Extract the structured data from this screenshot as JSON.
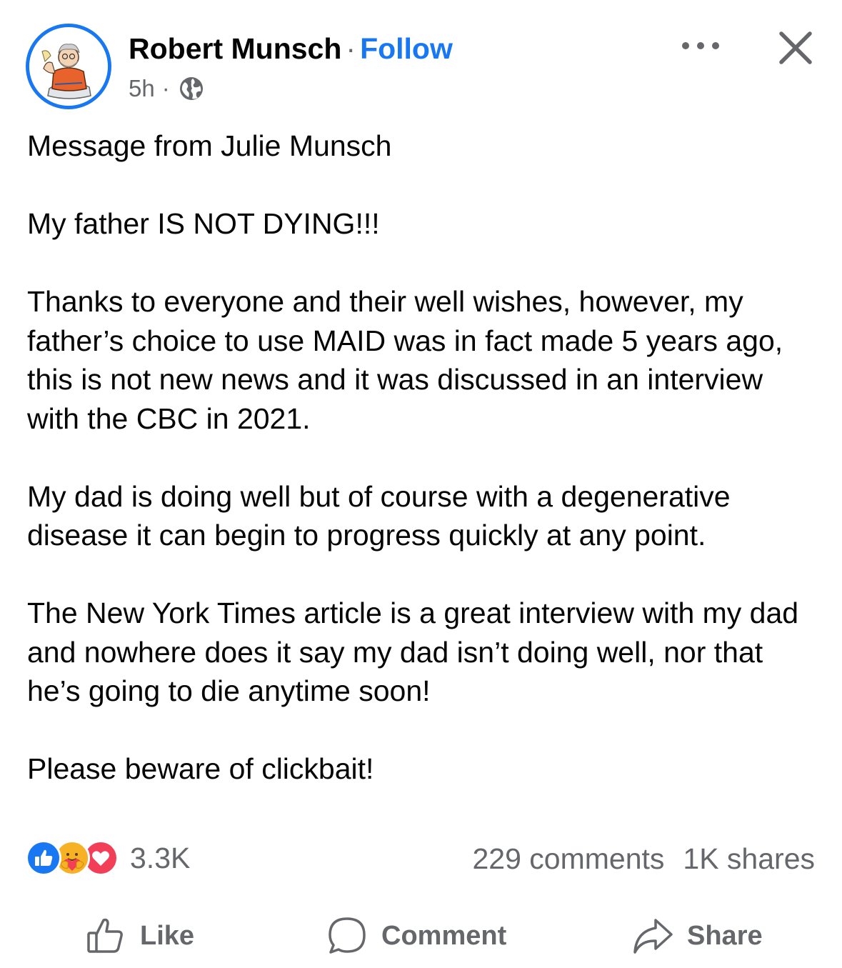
{
  "colors": {
    "accent": "#1877f2",
    "secondary_text": "#65676b",
    "primary_text": "#050505",
    "love": "#f33e58",
    "care": "#f7b125"
  },
  "post_header": {
    "author": "Robert Munsch",
    "separator": "·",
    "follow_label": "Follow",
    "timestamp": "5h",
    "meta_separator": "·",
    "audience_icon": "globe-icon",
    "more_icon": "more-options-icon",
    "close_icon": "close-icon"
  },
  "post_body": {
    "paragraphs": [
      "Message from Julie Munsch",
      "My father IS NOT DYING!!!",
      "Thanks to everyone and their well wishes, however, my father’s choice to use MAID was in fact made 5 years ago, this is not new news and it was discussed in an interview with the CBC in 2021.",
      "My dad is doing well but of course with a degenerative disease it can begin to progress quickly at any point.",
      "The New York Times article is a great interview with my dad and nowhere does it say my dad isn’t doing well, nor that he’s going to die anytime soon!",
      "Please beware of clickbait!"
    ]
  },
  "engagement": {
    "reaction_icons": [
      "like-reaction-icon",
      "care-reaction-icon",
      "love-reaction-icon"
    ],
    "reaction_count": "3.3K",
    "comments": "229 comments",
    "shares": "1K shares"
  },
  "actions": {
    "like_label": "Like",
    "comment_label": "Comment",
    "share_label": "Share"
  }
}
